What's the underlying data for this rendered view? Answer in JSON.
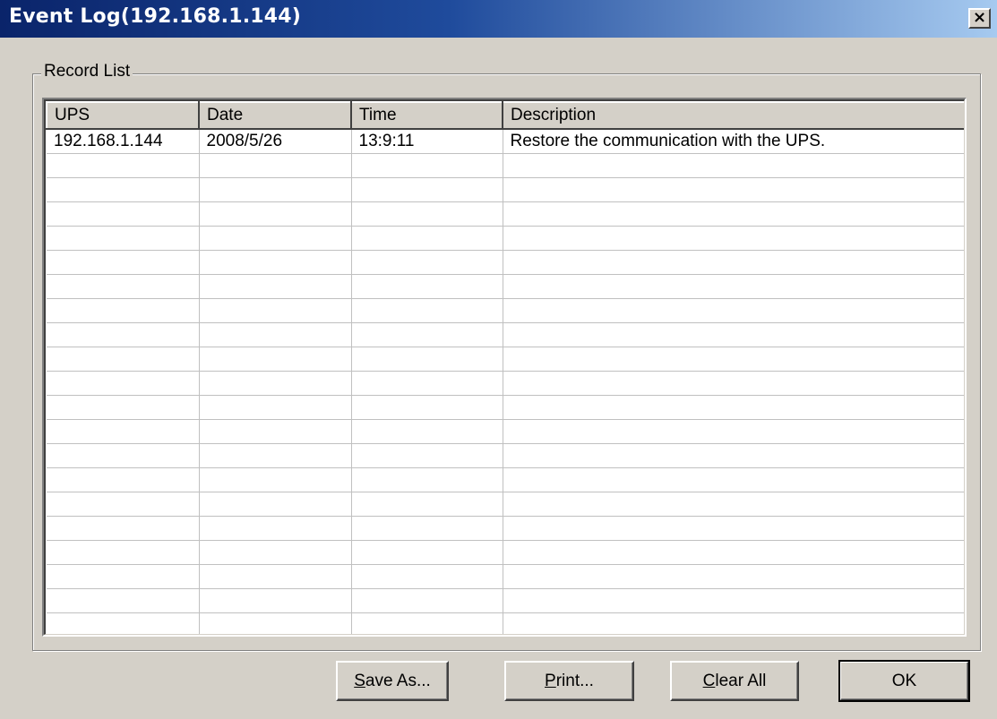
{
  "window": {
    "title": "Event Log(192.168.1.144)",
    "close_glyph": "×"
  },
  "record_list": {
    "label": "Record List",
    "columns": [
      "UPS",
      "Date",
      "Time",
      "Description"
    ],
    "rows": [
      [
        "192.168.1.144",
        "2008/5/26",
        "13:9:11",
        "Restore the communication with the UPS."
      ]
    ]
  },
  "buttons": {
    "save_as": {
      "mnemonic": "S",
      "rest": "ave As..."
    },
    "print": {
      "mnemonic": "P",
      "rest": "rint..."
    },
    "clear_all": {
      "mnemonic": "C",
      "rest": "lear All"
    },
    "ok": "OK"
  },
  "colors": {
    "face": "#d4d0c8",
    "title_start": "#0a246a",
    "title_end": "#a6caf0"
  }
}
